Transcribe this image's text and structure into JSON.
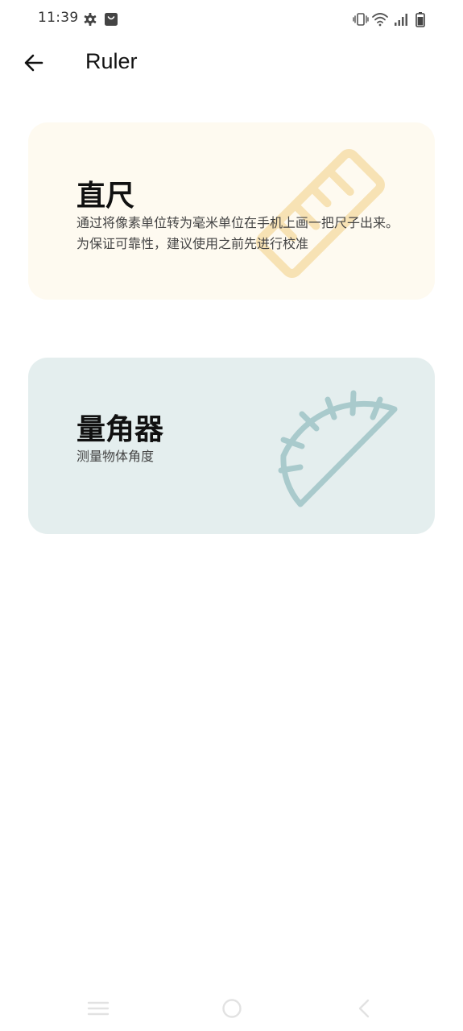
{
  "status_bar": {
    "time": "11:39",
    "icons": [
      "gear-icon",
      "bag-icon",
      "vibrate-icon",
      "wifi-icon",
      "signal-icon",
      "battery-icon"
    ]
  },
  "app_bar": {
    "title": "Ruler",
    "back_icon": "arrow-left-icon"
  },
  "cards": [
    {
      "title": "直尺",
      "description": "通过将像素单位转为毫米单位在手机上画一把尺子出来。为保证可靠性，建议使用之前先进行校准",
      "icon": "ruler-icon",
      "background": "#fefaf0",
      "accent": "#f7e2b4"
    },
    {
      "title": "量角器",
      "description": "测量物体角度",
      "icon": "protractor-icon",
      "background": "#e4eeee",
      "accent": "#a9cacc"
    }
  ],
  "nav_bar": {
    "icons": [
      "menu-icon",
      "home-icon",
      "back-icon"
    ]
  }
}
